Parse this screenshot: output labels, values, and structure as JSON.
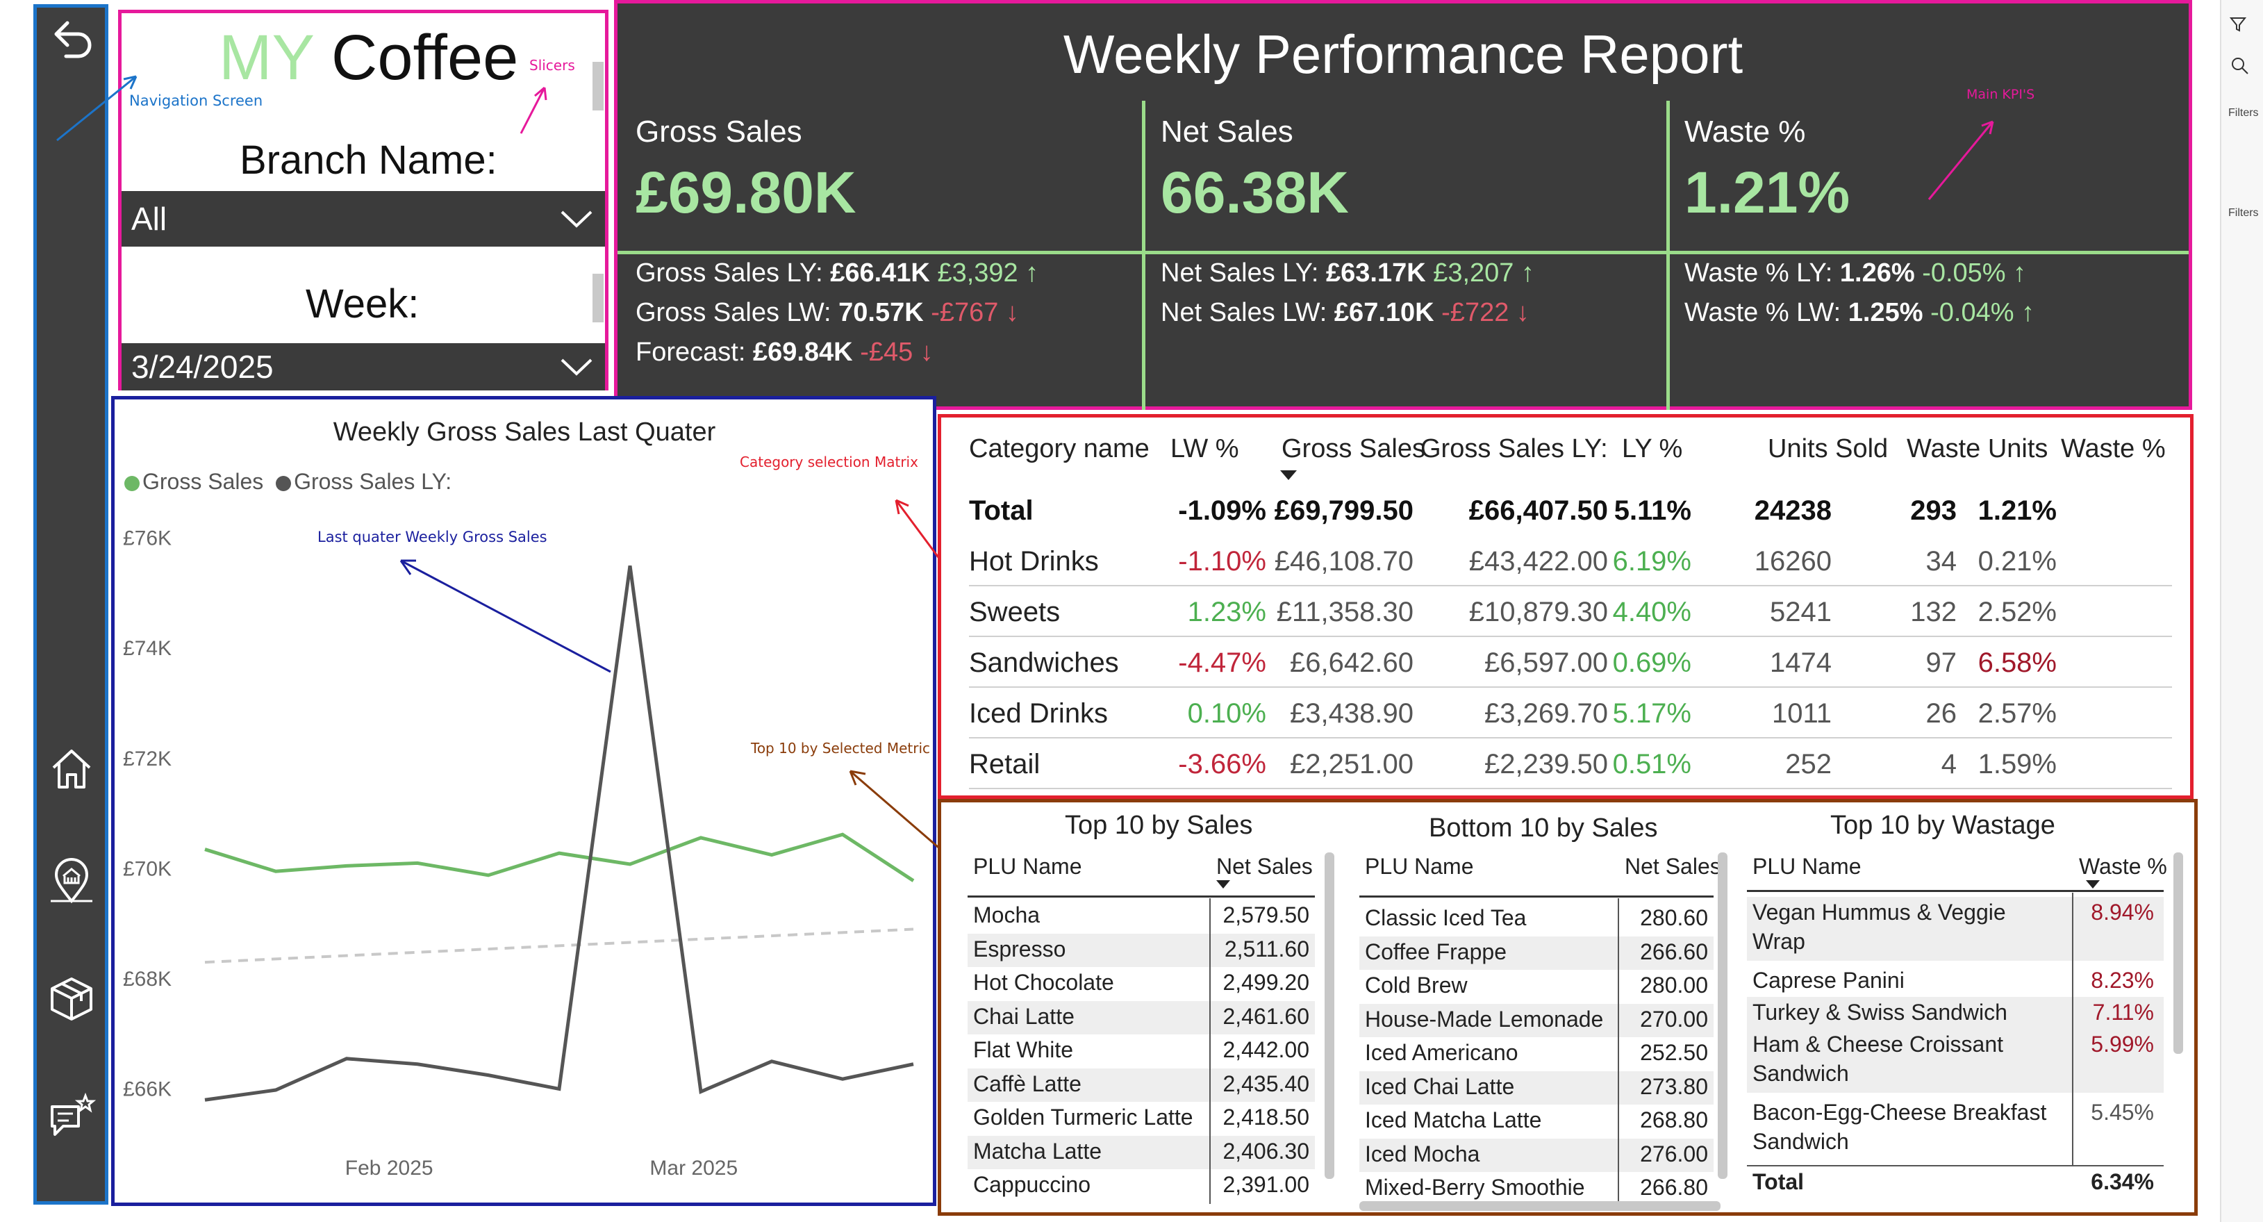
{
  "nav": {
    "icons": [
      "back-arrow-icon",
      "home-icon",
      "branch-location-icon",
      "inventory-box-icon",
      "feedback-icon"
    ]
  },
  "slicers": {
    "brand_a": "MY",
    "brand_b": "Coffee",
    "branch_label": "Branch Name:",
    "branch_value": "All",
    "week_label": "Week:",
    "week_value": "3/24/2025"
  },
  "annotations": {
    "navigation": "Navigation Screen",
    "slicers": "Slicers",
    "kpis": "Main KPI'S",
    "category_matrix": "Category selection Matrix",
    "chart": "Last quater Weekly Gross Sales",
    "top10": "Top 10 by Selected Metric"
  },
  "kpi": {
    "title": "Weekly Performance Report",
    "cards": [
      {
        "label": "Gross Sales",
        "value": "£69.80K"
      },
      {
        "label": "Net Sales",
        "value": "66.38K"
      },
      {
        "label": "Waste %",
        "value": "1.21%"
      }
    ],
    "gross_lines": [
      {
        "label": "Gross Sales LY: ",
        "value": "£66.41K",
        "delta": "£3,392",
        "dir": "up"
      },
      {
        "label": "Gross Sales LW: ",
        "value": "70.57K",
        "delta": "-£767",
        "dir": "down"
      },
      {
        "label": "Forecast: ",
        "value": "£69.84K",
        "delta": "-£45",
        "dir": "down"
      }
    ],
    "net_lines": [
      {
        "label": "Net Sales LY: ",
        "value": "£63.17K",
        "delta": "£3,207",
        "dir": "up"
      },
      {
        "label": "Net Sales LW: ",
        "value": "£67.10K",
        "delta": "-£722",
        "dir": "down"
      }
    ],
    "waste_lines": [
      {
        "label": "Waste % LY: ",
        "value": "1.26%",
        "delta": "-0.05%",
        "dir": "up"
      },
      {
        "label": "Waste % LW: ",
        "value": "1.25%",
        "delta": "-0.04%",
        "dir": "up"
      }
    ]
  },
  "chart_data": {
    "type": "line",
    "title": "Weekly Gross Sales Last Quater",
    "series": [
      {
        "name": "Gross Sales",
        "color": "#6db865",
        "values": [
          70350,
          69950,
          70050,
          70100,
          69880,
          70280,
          70080,
          70560,
          70250,
          70620,
          69780
        ]
      },
      {
        "name": "Gross Sales LY:",
        "color": "#555555",
        "values": [
          65800,
          65980,
          66550,
          66450,
          66250,
          66000,
          75500,
          65950,
          66500,
          66180,
          66450
        ]
      }
    ],
    "trend": {
      "color": "#c8c8c8",
      "values": [
        68300,
        68900
      ]
    },
    "y_ticks": [
      "£76K",
      "£74K",
      "£72K",
      "£70K",
      "£68K",
      "£66K"
    ],
    "y_tick_values": [
      76000,
      74000,
      72000,
      70000,
      68000,
      66000
    ],
    "ylim": [
      65400,
      76500
    ],
    "x_tick_labels": [
      "Feb 2025",
      "Mar 2025"
    ],
    "x_tick_index": [
      2.6,
      6.9
    ]
  },
  "matrix": {
    "headers": [
      "Category name",
      "LW %",
      "Gross Sales",
      "Gross Sales LY:",
      "LY %",
      "Units Sold",
      "Waste Units",
      "Waste %"
    ],
    "total": [
      "Total",
      "-1.09%",
      "£69,799.50",
      "£66,407.50",
      "5.11%",
      "24238",
      "293",
      "1.21%"
    ],
    "rows": [
      [
        "Hot Drinks",
        "-1.10%",
        "£46,108.70",
        "£43,422.00",
        "6.19%",
        "16260",
        "34",
        "0.21%"
      ],
      [
        "Sweets",
        "1.23%",
        "£11,358.30",
        "£10,879.30",
        "4.40%",
        "5241",
        "132",
        "2.52%"
      ],
      [
        "Sandwiches",
        "-4.47%",
        "£6,642.60",
        "£6,597.00",
        "0.69%",
        "1474",
        "97",
        "6.58%"
      ],
      [
        "Iced Drinks",
        "0.10%",
        "£3,438.90",
        "£3,269.70",
        "5.17%",
        "1011",
        "26",
        "2.57%"
      ],
      [
        "Retail",
        "-3.66%",
        "£2,251.00",
        "£2,239.50",
        "0.51%",
        "252",
        "4",
        "1.59%"
      ]
    ]
  },
  "top10_sales": {
    "title": "Top 10 by Sales",
    "col1": "PLU Name",
    "col2": "Net Sales",
    "rows": [
      [
        "Mocha",
        "2,579.50"
      ],
      [
        "Espresso",
        "2,511.60"
      ],
      [
        "Hot Chocolate",
        "2,499.20"
      ],
      [
        "Chai Latte",
        "2,461.60"
      ],
      [
        "Flat White",
        "2,442.00"
      ],
      [
        "Caffè Latte",
        "2,435.40"
      ],
      [
        "Golden Turmeric Latte",
        "2,418.50"
      ],
      [
        "Matcha Latte",
        "2,406.30"
      ],
      [
        "Cappuccino",
        "2,391.00"
      ]
    ]
  },
  "bottom10_sales": {
    "title": "Bottom 10 by Sales",
    "col1": "PLU Name",
    "col2": "Net Sales",
    "rows": [
      [
        "Classic Iced Tea",
        "280.60"
      ],
      [
        "Coffee Frappe",
        "266.60"
      ],
      [
        "Cold Brew",
        "280.00"
      ],
      [
        "House-Made Lemonade",
        "270.00"
      ],
      [
        "Iced Americano",
        "252.50"
      ],
      [
        "Iced Chai Latte",
        "273.80"
      ],
      [
        "Iced Matcha Latte",
        "268.80"
      ],
      [
        "Iced Mocha",
        "276.00"
      ],
      [
        "Mixed-Berry Smoothie",
        "266.80"
      ]
    ]
  },
  "top10_waste": {
    "title": "Top 10 by Wastage",
    "col1": "PLU Name",
    "col2": "Waste %",
    "rows": [
      [
        "Vegan Hummus & Veggie",
        "Wrap",
        "8.94%"
      ],
      [
        "Caprese Panini",
        "",
        "8.23%"
      ],
      [
        "Turkey & Swiss Sandwich",
        "",
        "7.11%"
      ],
      [
        "Ham & Cheese Croissant",
        "Sandwich",
        "5.99%"
      ],
      [
        "Bacon-Egg-Cheese Breakfast",
        "Sandwich",
        "5.45%"
      ]
    ],
    "total_label": "Total",
    "total_value": "6.34%"
  },
  "filters": {
    "label1": "Filters",
    "label2": "Filters"
  }
}
